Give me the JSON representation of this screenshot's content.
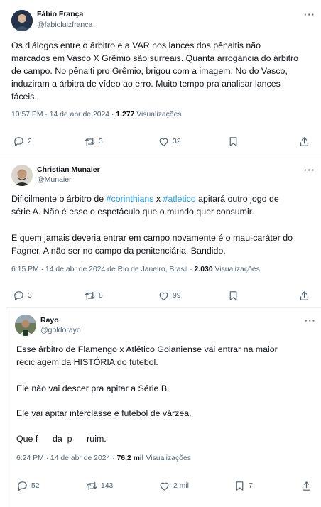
{
  "tweets": [
    {
      "name": "Fábio França",
      "handle": "@fabioluizfranca",
      "lines": [
        "Os diálogos entre o árbitro e a VAR nos lances dos pênaltis não",
        "marcados em Vasco X Grêmio são surreais. Quanta arrogância do árbitro",
        "de campo. No pênalti pro Grêmio, brigou com a imagem. No do Vasco,",
        "induziram a árbitra de vídeo ao erro. Muito tempo pra analisar lances",
        "fáceis."
      ],
      "timestamp": "10:57 PM · 14 de abr de 2024 · ",
      "views_count": "1.277",
      "views_label": " Visualizações",
      "replies": "2",
      "reposts": "3",
      "likes": "32",
      "views_action": ""
    },
    {
      "name": "Christian Munaier",
      "handle": "@Munaier",
      "line1_pre": "Dificilmente o árbitro de ",
      "line1_tag1": "#corinthians",
      "line1_mid": " x ",
      "line1_tag2": "#atletico",
      "line1_post": " apitará outro jogo de",
      "lines": [
        "série A. Não é esse o espetáculo que o mundo quer consumir.",
        "E quem jamais deveria entrar em campo novamente é o mau-caráter do",
        "Fagner. A não ser no campo da penitenciária. Bandido."
      ],
      "timestamp": "6:15 PM · 14 de abr de 2024 de Rio de Janeiro, Brasil · ",
      "views_count": "2.030",
      "views_label": " Visualizações",
      "replies": "3",
      "reposts": "8",
      "likes": "99"
    },
    {
      "name": "Rayo",
      "handle": "@goldorayo",
      "lines": [
        "Esse árbitro de Flamengo x Atlético Goianiense vai entrar na maior",
        "reciclagem da HISTÓRIA do futebol.",
        "Ele não vai descer pra apitar a Série B.",
        "Ele vai apitar interclasse e futebol de várzea.",
        "Que f      da  p      ruim."
      ],
      "timestamp": "6:24 PM · 14 de abr de 2024 · ",
      "views_count": "76,2 mil",
      "views_label": " Visualizações",
      "replies": "52",
      "reposts": "143",
      "likes": "2 mil",
      "bookmarks": "7"
    }
  ],
  "icons": {
    "more": "more-icon",
    "reply": "reply-icon",
    "repost": "repost-icon",
    "like": "like-icon",
    "bookmark": "bookmark-icon",
    "share": "share-icon"
  },
  "colors": {
    "link": "#1d9bf0",
    "text": "#0f1419",
    "muted": "#536471",
    "border": "#eff3f4"
  }
}
